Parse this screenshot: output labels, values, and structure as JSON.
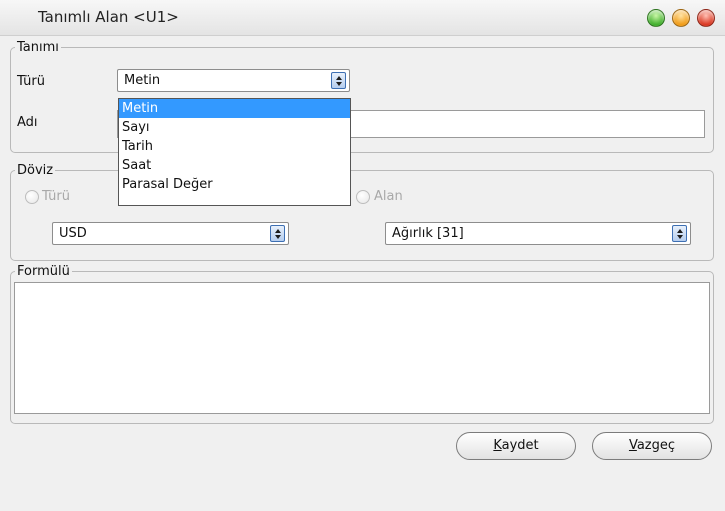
{
  "window": {
    "title": "Tanımlı Alan <U1>"
  },
  "tanimi": {
    "legend": "Tanımı",
    "turu_label": "Türü",
    "turu_value": "Metin",
    "adi_label": "Adı",
    "adi_value": "",
    "dropdown_options": [
      "Metin",
      "Sayı",
      "Tarih",
      "Saat",
      "Parasal Değer"
    ]
  },
  "doviz": {
    "legend": "Döviz",
    "radio_turu_label": "Türü",
    "radio_alan_label": "Alan",
    "currency_value": "USD",
    "alan_value": "Ağırlık [31]"
  },
  "formulu": {
    "legend": "Formülü",
    "value": ""
  },
  "buttons": {
    "save_mnemonic": "K",
    "save_rest": "aydet",
    "cancel_mnemonic": "V",
    "cancel_rest": "azgeç"
  }
}
